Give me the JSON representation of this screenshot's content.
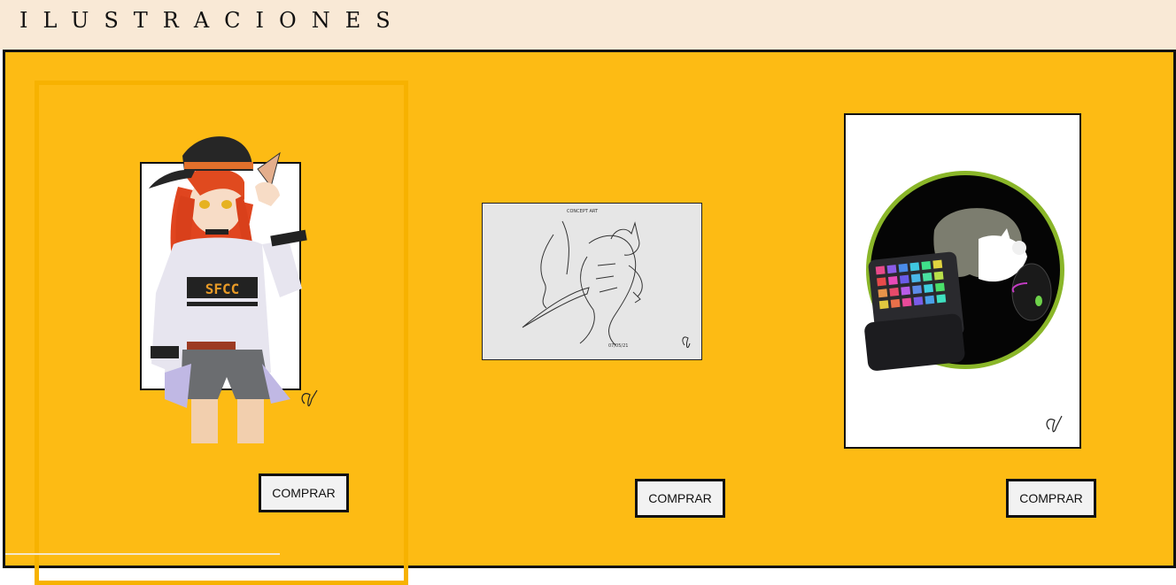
{
  "header": {
    "title": "ILUSTRACIONES"
  },
  "gallery": {
    "items": [
      {
        "buy_label": "COMPRAR",
        "badge_text": "SFCC"
      },
      {
        "buy_label": "COMPRAR",
        "sketch_caption": "CONCEPT ART"
      },
      {
        "buy_label": "COMPRAR"
      }
    ]
  },
  "colors": {
    "header_bg": "#f9e9d6",
    "gallery_bg": "#fdbb14",
    "frame_accent": "#f7b200"
  }
}
